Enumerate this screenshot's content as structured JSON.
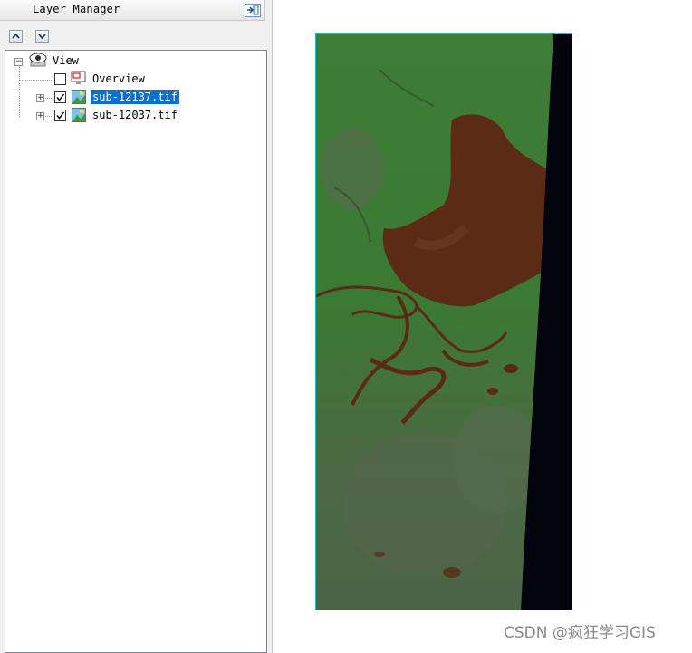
{
  "panel": {
    "title": "Layer Manager",
    "buttons": {
      "move_up": "▲",
      "move_down": "▼"
    }
  },
  "tree": {
    "root": {
      "label": "View",
      "icon": "eye-icon",
      "expanded": true
    },
    "items": [
      {
        "label": "Overview",
        "checked": false,
        "selected": false,
        "icon": "overview-icon",
        "has_children": false
      },
      {
        "label": "sub-12137.tif",
        "checked": true,
        "selected": true,
        "icon": "raster-layer-icon",
        "has_children": true
      },
      {
        "label": "sub-12037.tif",
        "checked": true,
        "selected": false,
        "icon": "raster-layer-icon",
        "has_children": true
      }
    ]
  },
  "map": {
    "content": "satellite raster layer",
    "colors": {
      "vegetation": "#3f7f3a",
      "water": "#5a2a14",
      "nodata": "#02030c",
      "frame": "#27b9c0"
    }
  },
  "watermark": "CSDN @疯狂学习GIS",
  "colors": {
    "selection": "#0a70d0",
    "panel_bg": "#f0f0f0"
  }
}
